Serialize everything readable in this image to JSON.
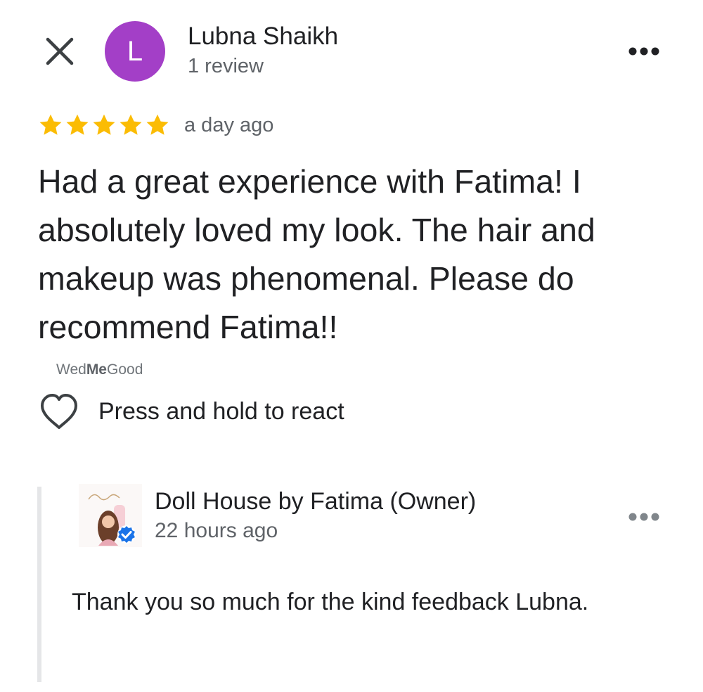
{
  "author": {
    "initial": "L",
    "name": "Lubna Shaikh",
    "meta": "1 review",
    "avatar_color": "#a33fc7"
  },
  "review": {
    "rating": 5,
    "max_rating": 5,
    "star_color": "#fbbc04",
    "time": "a day ago",
    "text": "Had a great experience with Fatima! I absolutely loved my look. The hair and makeup was phenomenal. Please do recommend Fatima!!",
    "source": {
      "prefix": "Wed",
      "bold": "Me",
      "suffix": "Good"
    }
  },
  "react": {
    "label": "Press and hold to react"
  },
  "owner_reply": {
    "name": "Doll House by Fatima (Owner)",
    "time": "22 hours ago",
    "text": "Thank you so much for the kind feedback Lubna.",
    "verified_color": "#1a73e8"
  },
  "icons": {
    "close": "close-icon",
    "more": "more-horizontal-icon",
    "star": "star-icon",
    "heart": "heart-outline-icon",
    "verified": "verified-badge-icon"
  }
}
